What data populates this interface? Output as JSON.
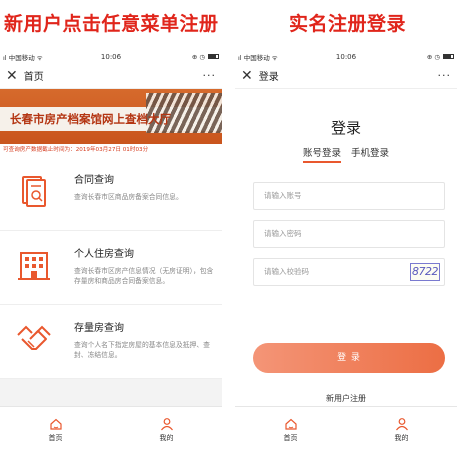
{
  "headings": {
    "left": "新用户点击任意菜单注册",
    "right": "实名注册登录"
  },
  "status_bar": {
    "carrier": "中国移动",
    "time": "10:06"
  },
  "left_screen": {
    "nav_title": "首页",
    "more": "···",
    "banner_text": "长春市房产档案馆网上查档大厅",
    "data_cutoff": "可查询房产数据截止时间为：2019年03月27日 01时03分",
    "services": [
      {
        "icon": "contract-document-icon",
        "title": "合同查询",
        "desc": "查询长春市区商品房备案合同信息。"
      },
      {
        "icon": "building-icon",
        "title": "个人住房查询",
        "desc": "查询长春市区房产信息情况（无房证明），包含存量房和商品房合同备案信息。"
      },
      {
        "icon": "handshake-icon",
        "title": "存量房查询",
        "desc": "查询个人名下指定房屋的基本信息及抵押、查封、冻结信息。"
      }
    ],
    "tabs": [
      {
        "icon": "home-icon",
        "label": "首页"
      },
      {
        "icon": "person-icon",
        "label": "我的"
      }
    ]
  },
  "right_screen": {
    "nav_title": "登录",
    "more": "···",
    "login_title": "登录",
    "tab_account": "账号登录",
    "tab_phone": "手机登录",
    "account_placeholder": "请输入账号",
    "password_placeholder": "请输入密码",
    "captcha_placeholder": "请输入校验码",
    "captcha_code": "8722",
    "login_button": "登 录",
    "register_link": "新用户注册",
    "tabs": [
      {
        "icon": "home-icon",
        "label": "首页"
      },
      {
        "icon": "person-icon",
        "label": "我的"
      }
    ]
  },
  "colors": {
    "accent": "#e0251b",
    "button": "#ec6e44"
  }
}
